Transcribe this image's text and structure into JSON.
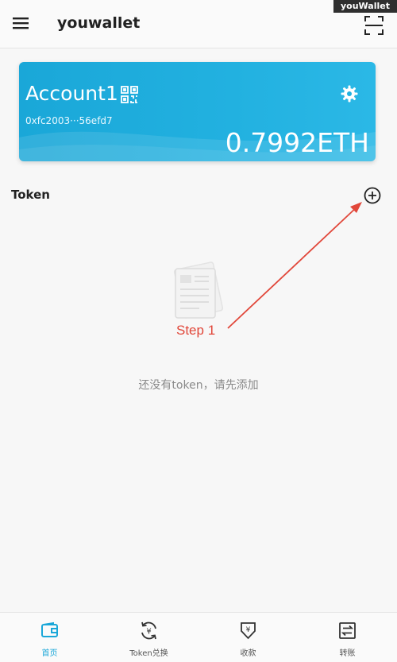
{
  "watermark": "youWallet",
  "header": {
    "title": "youwallet"
  },
  "account": {
    "name": "Account1",
    "address": "0xfc2003···56efd7",
    "balance": "0.7992ETH"
  },
  "token_section": {
    "label": "Token"
  },
  "empty_state": {
    "message": "还没有token，请先添加"
  },
  "annotation": {
    "label": "Step 1",
    "color": "#e1473a"
  },
  "bottom_nav": {
    "items": [
      {
        "label": "首页",
        "icon": "wallet-icon",
        "active": true
      },
      {
        "label": "Token兑换",
        "icon": "exchange-icon",
        "active": false
      },
      {
        "label": "收款",
        "icon": "receive-icon",
        "active": false
      },
      {
        "label": "转账",
        "icon": "transfer-icon",
        "active": false
      }
    ]
  },
  "colors": {
    "accent": "#1aa7d8",
    "card": "#22b1e0",
    "annotation": "#e1473a"
  }
}
